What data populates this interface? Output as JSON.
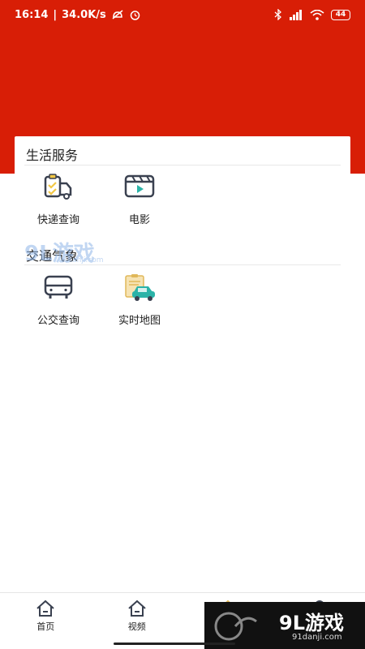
{
  "status_bar": {
    "time": "16:14",
    "speed": "34.0K/s",
    "battery": "44"
  },
  "sections": [
    {
      "title": "生活服务",
      "items": [
        {
          "label": "快递查询",
          "icon": "express-delivery-icon"
        },
        {
          "label": "电影",
          "icon": "movie-clapper-icon"
        }
      ]
    },
    {
      "title": "交通气象",
      "items": [
        {
          "label": "公交查询",
          "icon": "bus-icon"
        },
        {
          "label": "实时地图",
          "icon": "car-map-icon"
        }
      ]
    }
  ],
  "bottom_nav": [
    {
      "label": "首页",
      "icon": "home-icon"
    },
    {
      "label": "视频",
      "icon": "home-icon"
    },
    {
      "label": "",
      "icon": "home-icon"
    },
    {
      "label": "",
      "icon": "profile-icon"
    }
  ],
  "watermark": {
    "top_text": "9L游戏",
    "top_url": "91danji.com",
    "bottom_text": "9L游戏",
    "bottom_url": "91danji.com"
  },
  "colors": {
    "header": "#d81e06",
    "icon_stroke": "#3a4150",
    "icon_yellow": "#f2c744",
    "icon_teal": "#2bb3a8"
  }
}
